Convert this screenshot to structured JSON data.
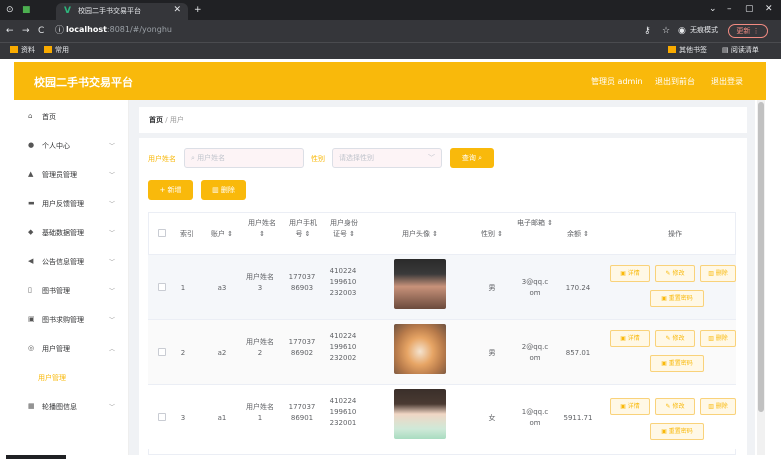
{
  "browser": {
    "tab_title": "校园二手书交易平台",
    "url_host": "localhost",
    "url_rest": ":8081/#/yonghu",
    "profile": "无痕模式",
    "update": "更新",
    "bookmarks": [
      "资料",
      "常用"
    ],
    "bookmarks_right": [
      "其他书签",
      "阅读清单"
    ]
  },
  "header": {
    "brand": "校园二手书交易平台",
    "admin": "管理员 admin",
    "back": "退出到前台",
    "logout": "退出登录"
  },
  "menu": [
    {
      "icon": "home-icon",
      "label": "首页"
    },
    {
      "icon": "user-icon",
      "label": "个人中心"
    },
    {
      "icon": "admin-icon",
      "label": "管理员管理"
    },
    {
      "icon": "feedback-icon",
      "label": "用户反馈管理"
    },
    {
      "icon": "data-icon",
      "label": "基础数据管理"
    },
    {
      "icon": "notice-icon",
      "label": "公告信息管理"
    },
    {
      "icon": "book-icon",
      "label": "图书管理"
    },
    {
      "icon": "cart-icon",
      "label": "图书求购管理"
    },
    {
      "icon": "users-icon",
      "label": "用户管理"
    },
    {
      "icon": "carousel-icon",
      "label": "轮播图信息"
    }
  ],
  "submenu_active": "用户管理",
  "breadcrumb": {
    "home": "首页",
    "sep": "/",
    "current": "用户"
  },
  "search": {
    "name_label": "用户姓名",
    "name_placeholder": "用户姓名",
    "sex_label": "性别",
    "sex_placeholder": "请选择性别",
    "query": "查询"
  },
  "actions": {
    "add": "+ 新增",
    "delete": "删除"
  },
  "columns": [
    "索引",
    "账户",
    "用户姓名",
    "用户手机号",
    "用户身份证号",
    "用户头像",
    "性别",
    "电子邮箱",
    "余额",
    "操作"
  ],
  "rows": [
    {
      "index": "1",
      "account": "a3",
      "name": "用户姓名3",
      "phone": "17703786903",
      "idcard": "410224199610232003",
      "sex": "男",
      "email": "3@qq.com",
      "balance": "170.24"
    },
    {
      "index": "2",
      "account": "a2",
      "name": "用户姓名2",
      "phone": "17703786902",
      "idcard": "410224199610232002",
      "sex": "男",
      "email": "2@qq.com",
      "balance": "857.01"
    },
    {
      "index": "3",
      "account": "a1",
      "name": "用户姓名1",
      "phone": "17703786901",
      "idcard": "410224199610232001",
      "sex": "女",
      "email": "1@qq.com",
      "balance": "5911.71"
    }
  ],
  "row_actions": {
    "detail": "详情",
    "edit": "修改",
    "delete": "删除",
    "reset": "重置密码"
  },
  "colors": {
    "accent": "#f9b90b"
  }
}
